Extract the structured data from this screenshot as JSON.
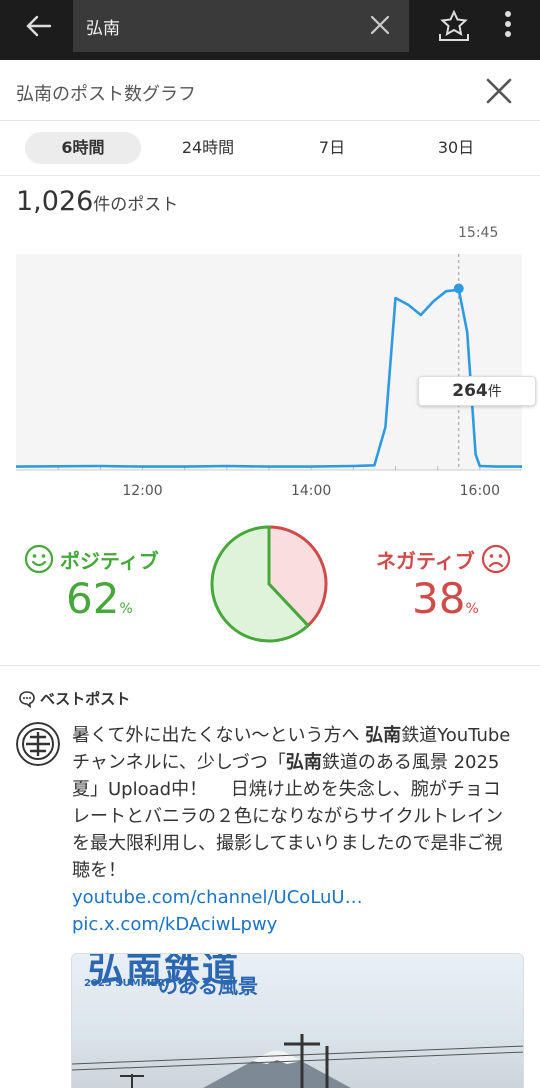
{
  "search": {
    "query": "弘南"
  },
  "panel": {
    "title": "弘南のポスト数グラフ"
  },
  "tabs": [
    "6時間",
    "24時間",
    "7日",
    "30日"
  ],
  "summary": {
    "count": "1,026",
    "unit": "件のポスト"
  },
  "chart_data": {
    "type": "line",
    "marker_time": "15:45",
    "marker_value": 264,
    "marker_label": "264",
    "marker_unit": "件",
    "x_ticks": [
      "12:00",
      "14:00",
      "16:00"
    ],
    "x_tick_hours": [
      12,
      14,
      16
    ],
    "xlim": [
      10.5,
      16.5
    ],
    "ylim": [
      0,
      300
    ],
    "x": [
      10.5,
      11.5,
      12.0,
      12.5,
      13.0,
      13.5,
      14.0,
      14.5,
      14.75,
      14.88,
      15.0,
      15.15,
      15.3,
      15.45,
      15.6,
      15.75,
      15.85,
      15.95,
      16.0,
      16.2,
      16.5
    ],
    "y": [
      2,
      3,
      2,
      2,
      3,
      2,
      2,
      3,
      4,
      60,
      250,
      240,
      225,
      245,
      260,
      262,
      200,
      20,
      3,
      2,
      2
    ],
    "color": "#2e9be0"
  },
  "sentiment": {
    "positive_label": "ポジティブ",
    "positive_value": "62",
    "positive_fraction": 0.62,
    "negative_label": "ネガティブ",
    "negative_value": "38",
    "negative_fraction": 0.38,
    "pct": "%",
    "positive_color": "#46a83a",
    "negative_color": "#d04a4a"
  },
  "best_post": {
    "heading": "ベストポスト",
    "text_1": "暑くて外に出たくない〜という方へ ",
    "bold_1": "弘南",
    "text_2": "鉄道YouTubeチャンネルに、少しづつ「",
    "bold_2": "弘南",
    "text_3": "鉄道のある風景 2025夏」Upload中！　 日焼け止めを失念し、腕がチョコレートとバニラの２色になりながらサイクルトレインを最大限利用し、撮影してまいりましたので是非ご視聴を！",
    "link_1": "youtube.com/channel/UCoLuU…",
    "link_2": "pic.x.com/kDAciwLpwy",
    "media_title": "弘南鉄道",
    "media_tag": "2025 SUMMER",
    "media_subtitle": "のある風景"
  }
}
